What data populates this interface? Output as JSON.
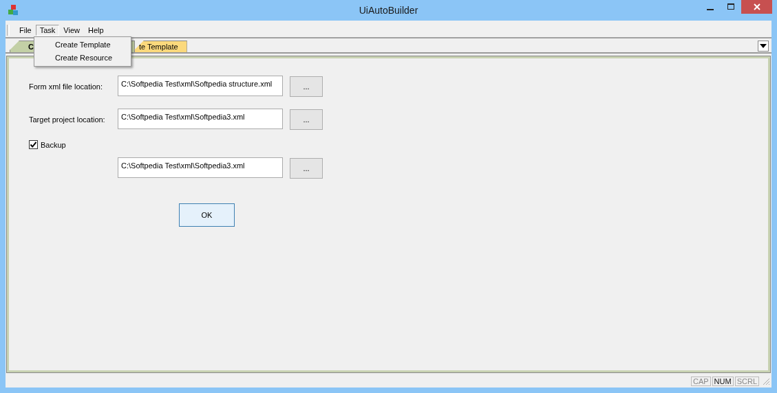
{
  "window": {
    "title": "UiAutoBuilder"
  },
  "menu_bar": [
    {
      "label": "File",
      "selected": false
    },
    {
      "label": "Task",
      "selected": true
    },
    {
      "label": "View",
      "selected": false
    },
    {
      "label": "Help",
      "selected": false
    }
  ],
  "task_menu": {
    "items": [
      "Create Template",
      "Create Resource"
    ]
  },
  "tabs": [
    {
      "label": "C",
      "selected": true,
      "color": "#c3d0a6"
    },
    {
      "label": "te Template",
      "selected": false,
      "color": "#fbd97c"
    }
  ],
  "form": {
    "rows": [
      {
        "kind": "field",
        "label": "Form xml file location:",
        "value": "C:\\Softpedia Test\\xml\\Softpedia structure.xml",
        "button": "..."
      },
      {
        "kind": "field",
        "label": "Target project location:",
        "value": "C:\\Softpedia Test\\xml\\Softpedia3.xml",
        "button": "..."
      },
      {
        "kind": "checkbox",
        "label": "Backup",
        "checked": true
      },
      {
        "kind": "field",
        "label": "",
        "value": "C:\\Softpedia Test\\xml\\Softpedia3.xml",
        "button": "..."
      }
    ],
    "ok_button": "OK"
  },
  "status_bar": [
    {
      "label": "CAP",
      "on": false
    },
    {
      "label": "NUM",
      "on": true
    },
    {
      "label": "SCRL",
      "on": false
    }
  ]
}
